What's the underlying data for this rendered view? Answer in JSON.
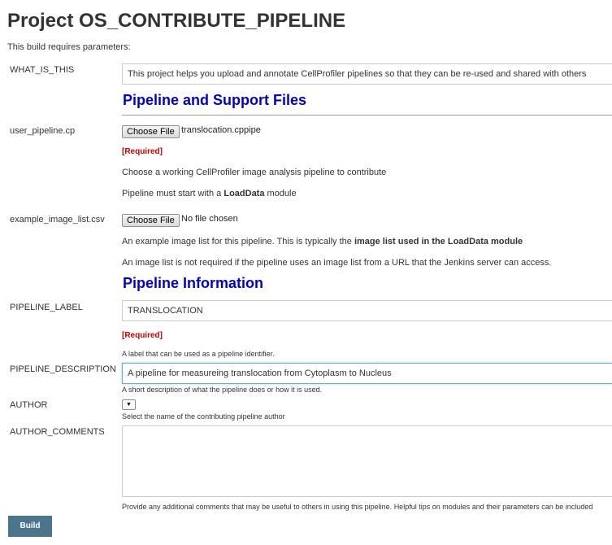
{
  "page": {
    "title": "Project OS_CONTRIBUTE_PIPELINE",
    "subtitle": "This build requires parameters:"
  },
  "params": {
    "what_is_this": {
      "label": "WHAT_IS_THIS",
      "value": "This project helps you upload and annotate CellProfiler pipelines so that they can be re-used and shared with others"
    },
    "section1": "Pipeline and Support Files",
    "user_pipeline": {
      "label": "user_pipeline.cp",
      "button": "Choose File",
      "file": "translocation.cppipe",
      "required": "[Required]",
      "desc1": "Choose a working CellProfiler image analysis pipeline to contribute",
      "desc2_pre": "Pipeline must start with a ",
      "desc2_bold": "LoadData",
      "desc2_post": " module"
    },
    "example_image_list": {
      "label": "example_image_list.csv",
      "button": "Choose File",
      "file": "No file chosen",
      "desc1_pre": "An example image list for this pipeline. This is typically the ",
      "desc1_bold": "image list used in the LoadData module",
      "desc2": "An image list is not required if the pipeline uses an image list from a URL that the Jenkins server can access."
    },
    "section2": "Pipeline Information",
    "pipeline_label": {
      "label": "PIPELINE_LABEL",
      "value": "TRANSLOCATION",
      "required": "[Required]",
      "desc": "A label that can be used as a pipeline identifier."
    },
    "pipeline_description": {
      "label": "PIPELINE_DESCRIPTION",
      "value": "A pipeline for measureing translocation from Cytoplasm to Nucleus",
      "desc": "A short description of what the pipeline does or how it is used."
    },
    "author": {
      "label": "AUTHOR",
      "arrow": "▼",
      "desc": "Select the name of the contributing pipeline author"
    },
    "author_comments": {
      "label": "AUTHOR_COMMENTS",
      "desc": "Provide any additional comments that may be useful to others in using this pipeline. Helpful tips on modules and their parameters can be included"
    }
  },
  "build_button": "Build"
}
